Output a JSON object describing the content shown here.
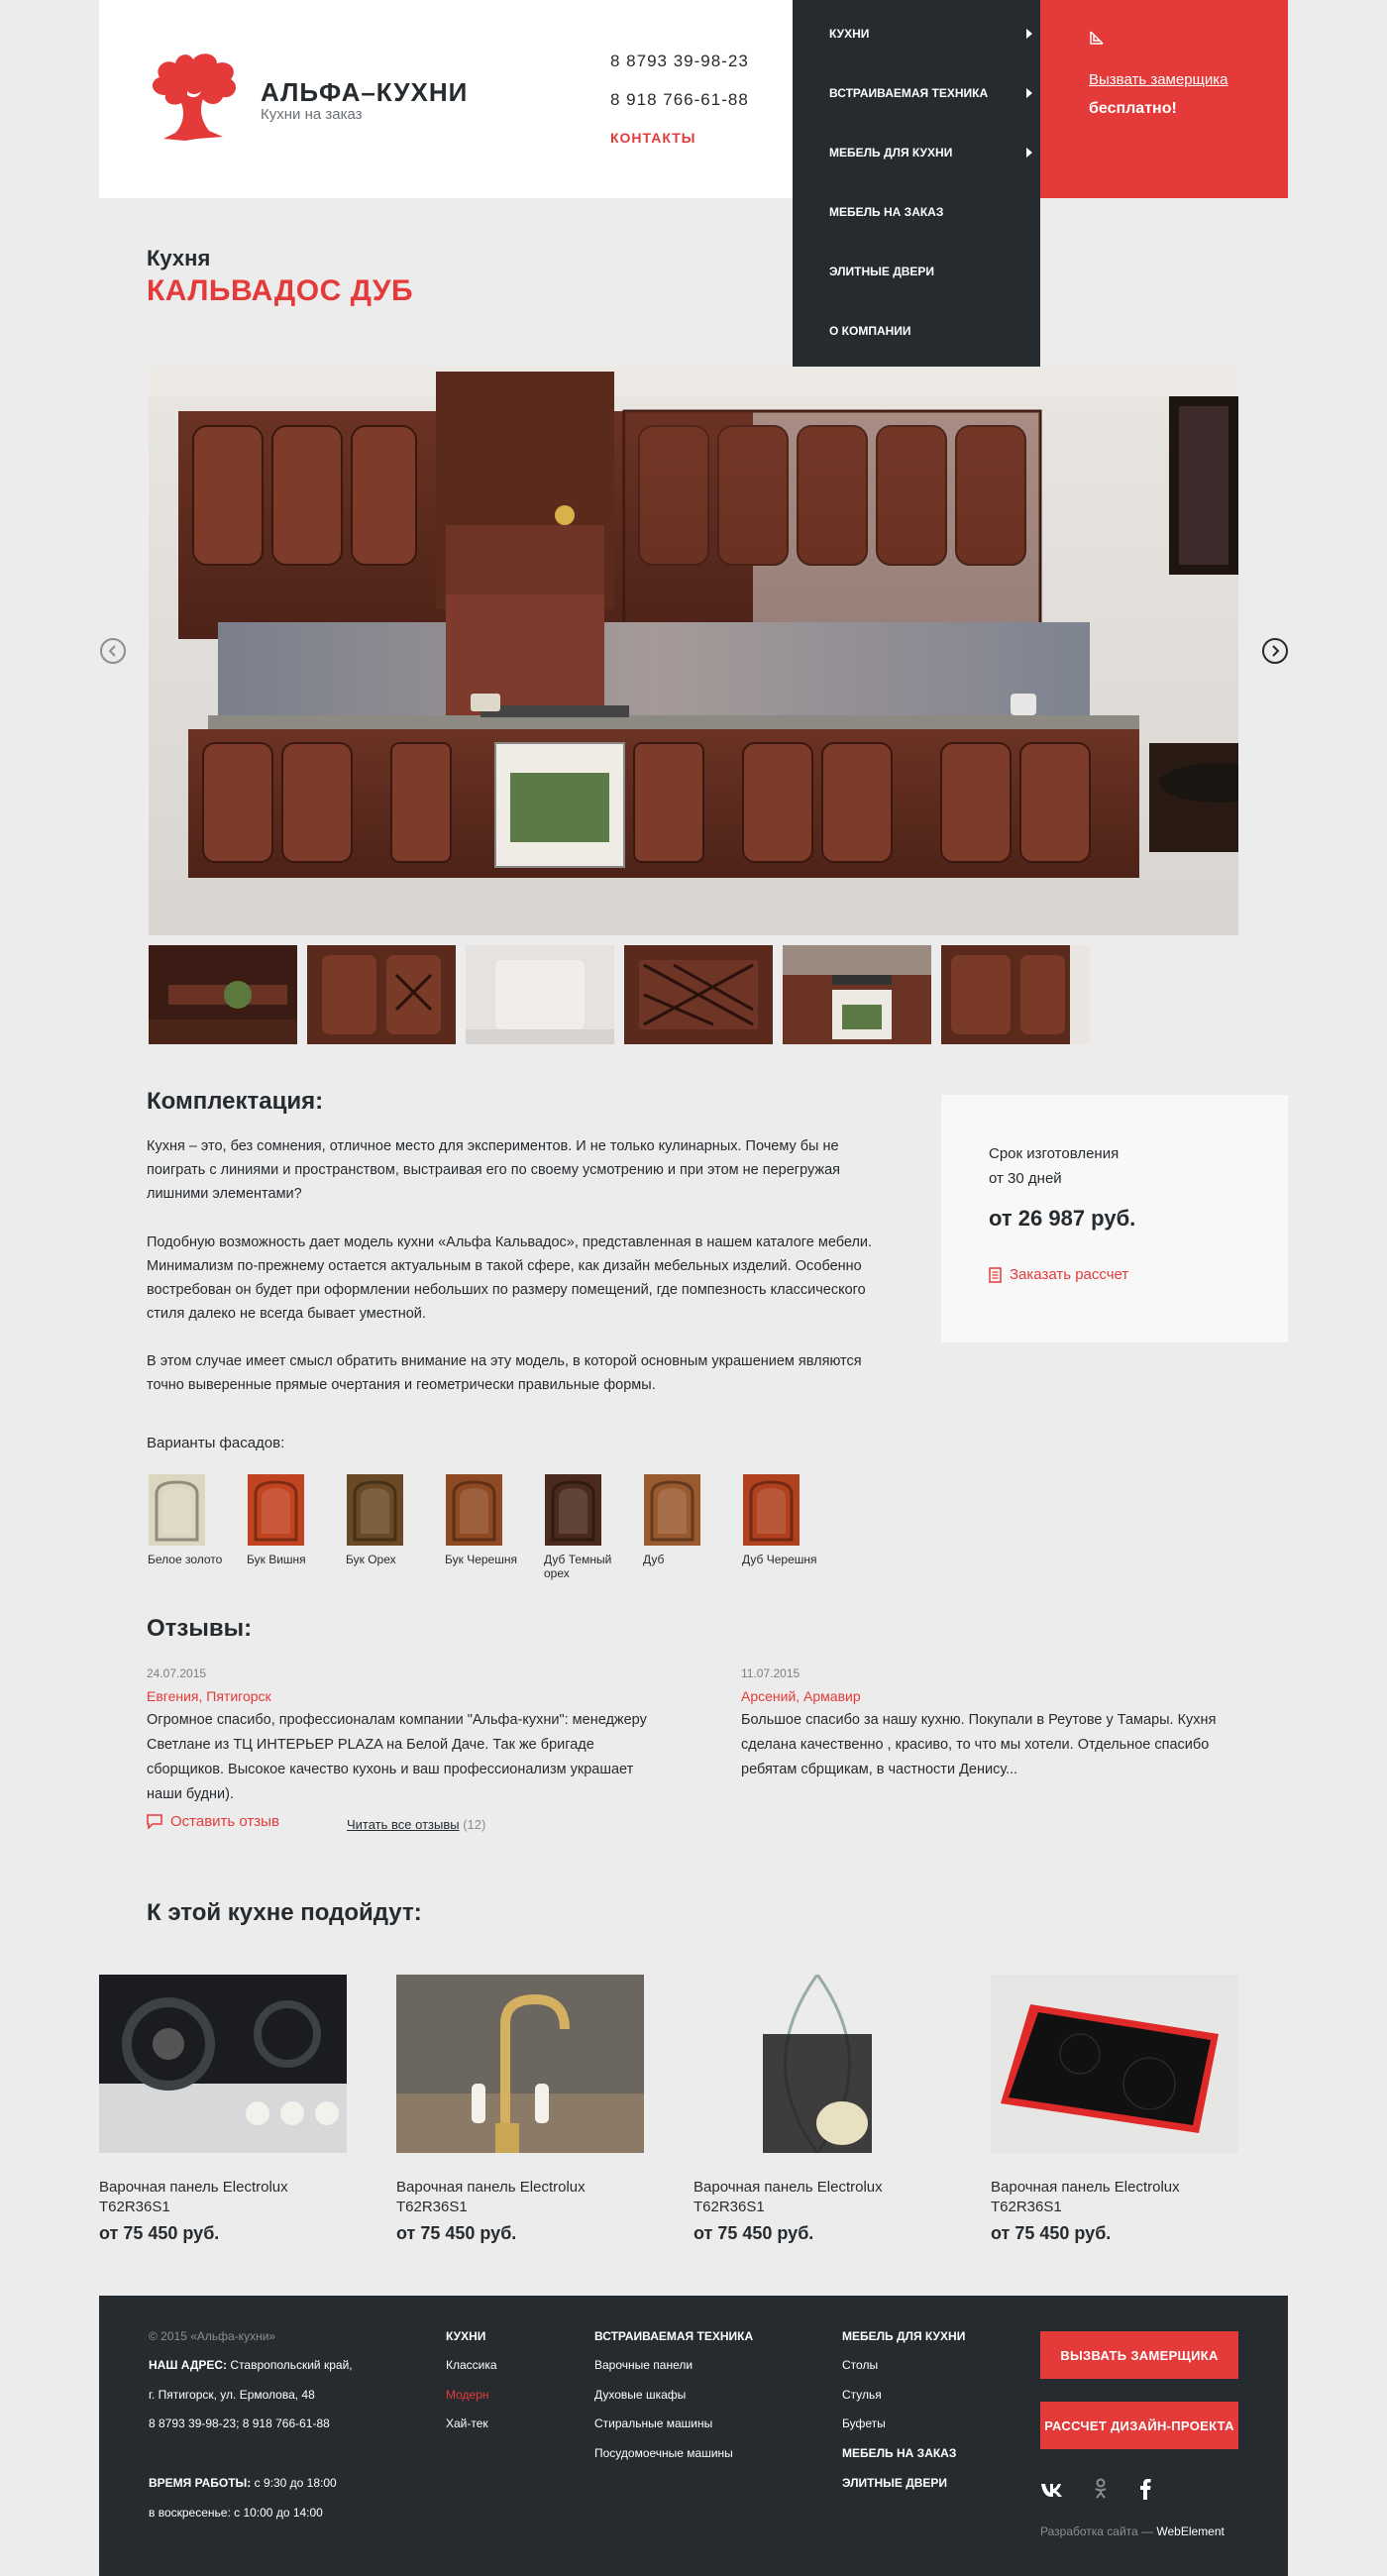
{
  "brand": {
    "name": "АЛЬФА–КУХНИ",
    "tagline": "Кухни на заказ"
  },
  "header": {
    "phones": [
      "8 8793 39-98-23",
      "8 918 766-61-88"
    ],
    "contacts_label": "КОНТАКТЫ"
  },
  "menu": {
    "items": [
      {
        "label": "КУХНИ",
        "has_submenu": true
      },
      {
        "label": "ВСТРАИВАЕМАЯ ТЕХНИКА",
        "has_submenu": true
      },
      {
        "label": "МЕБЕЛЬ ДЛЯ КУХНИ",
        "has_submenu": true
      },
      {
        "label": "МЕБЕЛЬ НА ЗАКАЗ",
        "has_submenu": false
      },
      {
        "label": "ЭЛИТНЫЕ ДВЕРИ",
        "has_submenu": false
      },
      {
        "label": "О КОМПАНИИ",
        "has_submenu": false
      }
    ]
  },
  "cta": {
    "link": "Вызвать замерщика",
    "free": "бесплатно!",
    "icon": "ruler-icon"
  },
  "product": {
    "category": "Кухня",
    "title": "КАЛЬВАДОС ДУБ"
  },
  "gallery": {
    "prev_icon": "chevron-left-icon",
    "next_icon": "chevron-right-icon",
    "thumb_count": 6
  },
  "description": {
    "heading": "Комплектация:",
    "paragraphs": [
      "Кухня – это, без сомнения, отличное место для экспериментов. И не только кулинарных. Почему бы не поиграть с линиями и пространством, выстраивая его по своему усмотрению и при этом не перегружая лишними элементами?",
      "Подобную возможность дает модель кухни «Альфа Кальвадос», представленная в нашем каталоге мебели. Минимализм по-прежнему остается актуальным в такой сфере, как дизайн мебельных изделий. Особенно востребован он будет при оформлении небольших по размеру помещений, где помпезность классического стиля далеко не всегда бывает уместной.",
      "В этом случае имеет смысл обратить внимание на эту модель, в которой основным украшением являются точно выверенные прямые очертания и геометрически правильные формы."
    ]
  },
  "pricing": {
    "term_label": "Срок изготовления",
    "term_value": "от 30 дней",
    "price": "от 26 987 руб.",
    "order_label": "Заказать рассчет"
  },
  "facades": {
    "label": "Варианты фасадов:",
    "items": [
      {
        "name": "Белое золото",
        "color": "#dcd6c0"
      },
      {
        "name": "Бук Вишня",
        "color": "#c2431f"
      },
      {
        "name": "Бук Орех",
        "color": "#6a4a26"
      },
      {
        "name": "Бук Черешня",
        "color": "#8f4a24"
      },
      {
        "name": "Дуб Темный орех",
        "color": "#4a2a1e"
      },
      {
        "name": "Дуб",
        "color": "#9a5a30"
      },
      {
        "name": "Дуб Черешня",
        "color": "#b0401e"
      }
    ]
  },
  "reviews": {
    "heading": "Отзывы:",
    "items": [
      {
        "date": "24.07.2015",
        "author": "Евгения, Пятигорск",
        "text": "Огромное спасибо, профессионалам компании \"Альфа-кухни\": менеджеру Светлане из ТЦ ИНТЕРЬЕР PLAZA на Белой Даче. Так же бригаде сборщиков. Высокое качество кухонь и ваш профессионализм украшает наши будни)."
      },
      {
        "date": "11.07.2015",
        "author": "Арсений, Армавир",
        "text": "Большое спасибо за нашу кухню. Покупали в Реутове у Тамары. Кухня сделана качественно , красиво, то что мы хотели. Отдельное спасибо ребятам сбрщикам, в частности Денису..."
      }
    ],
    "leave_label": "Оставить отзыв",
    "read_all_label": "Читать все отзывы",
    "read_all_count": "(12)"
  },
  "related": {
    "heading": "К этой кухне подойдут:",
    "items": [
      {
        "name": "Варочная панель Electrolux T62R36S1",
        "price": "от 75 450 руб."
      },
      {
        "name": "Варочная панель Electrolux T62R36S1",
        "price": "от 75 450 руб."
      },
      {
        "name": "Варочная панель Electrolux T62R36S1",
        "price": "от 75 450 руб."
      },
      {
        "name": "Варочная панель Electrolux T62R36S1",
        "price": "от 75 450 руб."
      }
    ]
  },
  "footer": {
    "copyright": "© 2015  «Альфа-кухни»",
    "address_label": "НАШ АДРЕС:",
    "address_line1": " Ставропольский край,",
    "address_line2": "г. Пятигорск, ул. Ермолова, 48",
    "phones": "8 8793 39-98-23; 8 918 766-61-88",
    "hours_label": "ВРЕМЯ РАБОТЫ:",
    "hours_weekday": " с 9:30 до 18:00",
    "hours_sunday": "в воскресенье: с 10:00 до 14:00",
    "col_kitchens": {
      "title": "КУХНИ",
      "items": [
        "Классика",
        "Модерн",
        "Хай-тек"
      ]
    },
    "col_appliances": {
      "title": "ВСТРАИВАЕМАЯ ТЕХНИКА",
      "items": [
        "Варочные панели",
        "Духовые шкафы",
        "Стиральные машины",
        "Посудомоечные машины"
      ]
    },
    "col_furniture": {
      "title": "МЕБЕЛЬ ДЛЯ КУХНИ",
      "items": [
        "Столы",
        "Стулья",
        "Буфеты"
      ],
      "extra": [
        "МЕБЕЛЬ НА ЗАКАЗ",
        "ЭЛИТНЫЕ ДВЕРИ"
      ]
    },
    "btn_measure": "ВЫЗВАТЬ ЗАМЕРЩИКА",
    "btn_design": "РАССЧЕТ ДИЗАЙН-ПРОЕКТА",
    "social": [
      "vk-icon",
      "odnoklassniki-icon",
      "facebook-icon"
    ],
    "dev_prefix": "Разработка сайта — ",
    "dev_name": "WebElement"
  },
  "colors": {
    "accent": "#e53a3a",
    "dark": "#262b2f",
    "bg": "#ececec"
  }
}
